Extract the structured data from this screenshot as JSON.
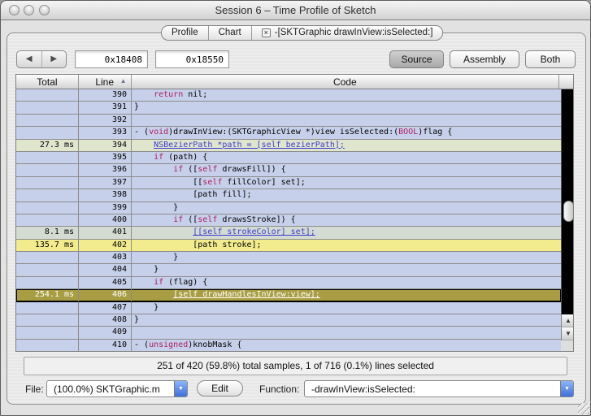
{
  "window": {
    "title": "Session 6 – Time Profile of Sketch"
  },
  "tabs": {
    "profile": "Profile",
    "chart": "Chart",
    "function_tab": "-[SKTGraphic drawInView:isSelected:]",
    "close_icon": "×"
  },
  "toolbar": {
    "back_icon": "◀",
    "forward_icon": "▶",
    "addr_start": "0x18408",
    "addr_end": "0x18550",
    "source_button": "Source",
    "assembly_button": "Assembly",
    "both_button": "Both",
    "selected_view": "Source"
  },
  "table": {
    "headers": {
      "total": "Total",
      "line": "Line",
      "code": "Code"
    },
    "sort_icon": "▲",
    "rows": [
      {
        "line": "390",
        "total": "",
        "bg": "blue",
        "segs": [
          {
            "t": "    "
          },
          {
            "t": "return",
            "c": "kw"
          },
          {
            "t": " nil;"
          }
        ]
      },
      {
        "line": "391",
        "total": "",
        "bg": "blue",
        "segs": [
          {
            "t": "}"
          }
        ]
      },
      {
        "line": "392",
        "total": "",
        "bg": "blue",
        "segs": [
          {
            "t": ""
          }
        ]
      },
      {
        "line": "393",
        "total": "",
        "bg": "blue",
        "segs": [
          {
            "t": "- ("
          },
          {
            "t": "void",
            "c": "kw"
          },
          {
            "t": ")drawInView:(SKTGraphicView *)view isSelected:("
          },
          {
            "t": "BOOL",
            "c": "kw"
          },
          {
            "t": ")flag {"
          }
        ]
      },
      {
        "line": "394",
        "total": "27.3 ms",
        "bg": "green",
        "segs": [
          {
            "t": "    "
          },
          {
            "t": "NSBezierPath *path = [self bezierPath];",
            "c": "link"
          }
        ]
      },
      {
        "line": "395",
        "total": "",
        "bg": "blue",
        "segs": [
          {
            "t": "    "
          },
          {
            "t": "if",
            "c": "kw"
          },
          {
            "t": " (path) {"
          }
        ]
      },
      {
        "line": "396",
        "total": "",
        "bg": "blue",
        "segs": [
          {
            "t": "        "
          },
          {
            "t": "if",
            "c": "kw"
          },
          {
            "t": " (["
          },
          {
            "t": "self",
            "c": "kw"
          },
          {
            "t": " drawsFill]) {"
          }
        ]
      },
      {
        "line": "397",
        "total": "",
        "bg": "blue",
        "segs": [
          {
            "t": "            [["
          },
          {
            "t": "self",
            "c": "kw"
          },
          {
            "t": " fillColor] set];"
          }
        ]
      },
      {
        "line": "398",
        "total": "",
        "bg": "blue",
        "segs": [
          {
            "t": "            [path fill];"
          }
        ]
      },
      {
        "line": "399",
        "total": "",
        "bg": "blue",
        "segs": [
          {
            "t": "        }"
          }
        ]
      },
      {
        "line": "400",
        "total": "",
        "bg": "blue",
        "segs": [
          {
            "t": "        "
          },
          {
            "t": "if",
            "c": "kw"
          },
          {
            "t": " (["
          },
          {
            "t": "self",
            "c": "kw"
          },
          {
            "t": " drawsStroke]) {"
          }
        ]
      },
      {
        "line": "401",
        "total": "8.1 ms",
        "bg": "graygreen",
        "segs": [
          {
            "t": "            "
          },
          {
            "t": "[[self strokeColor] set];",
            "c": "link"
          }
        ]
      },
      {
        "line": "402",
        "total": "135.7 ms",
        "bg": "yellow",
        "segs": [
          {
            "t": "            [path stroke];"
          }
        ]
      },
      {
        "line": "403",
        "total": "",
        "bg": "blue",
        "segs": [
          {
            "t": "        }"
          }
        ]
      },
      {
        "line": "404",
        "total": "",
        "bg": "blue",
        "segs": [
          {
            "t": "    }"
          }
        ]
      },
      {
        "line": "405",
        "total": "",
        "bg": "blue",
        "segs": [
          {
            "t": "    "
          },
          {
            "t": "if",
            "c": "kw"
          },
          {
            "t": " (flag) {"
          }
        ]
      },
      {
        "line": "406",
        "total": "254.1 ms",
        "bg": "selected",
        "segs": [
          {
            "t": "        "
          },
          {
            "t": "[self drawHandlesInView:view];",
            "c": "linksel"
          }
        ]
      },
      {
        "line": "407",
        "total": "",
        "bg": "blue",
        "segs": [
          {
            "t": "    }"
          }
        ]
      },
      {
        "line": "408",
        "total": "",
        "bg": "blue",
        "segs": [
          {
            "t": "}"
          }
        ]
      },
      {
        "line": "409",
        "total": "",
        "bg": "blue",
        "segs": [
          {
            "t": ""
          }
        ]
      },
      {
        "line": "410",
        "total": "",
        "bg": "blue",
        "segs": [
          {
            "t": "- ("
          },
          {
            "t": "unsigned",
            "c": "kw"
          },
          {
            "t": ")knobMask {"
          }
        ]
      }
    ]
  },
  "scrollbar": {
    "up_icon": "▲",
    "down_icon": "▼"
  },
  "statusbar": {
    "text": "251 of 420 (59.8%) total samples, 1 of 716 (0.1%) lines selected"
  },
  "footer": {
    "file_label": "File:",
    "file_value": "(100.0%) SKTGraphic.m",
    "edit_button": "Edit",
    "function_label": "Function:",
    "function_value": "-drawInView:isSelected:",
    "popup_arrow": "▼"
  },
  "colors": {
    "row_blue": "#c6d0ea",
    "row_green": "#e0e5ce",
    "row_graygreen": "#d3dbd3",
    "row_yellow": "#f2ec8e",
    "row_selected": "#a89d43",
    "keyword": "#ae1e63",
    "link": "#3c3ccf"
  }
}
